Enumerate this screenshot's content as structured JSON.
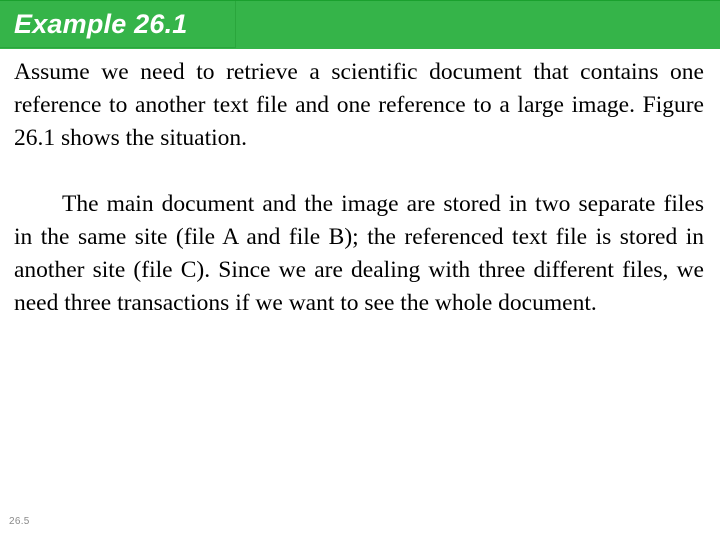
{
  "slide": {
    "title": "Example 26.1",
    "page_number": "26.5",
    "accent_color": "#35b449",
    "title_color": "#ffffff",
    "body_color": "#000000",
    "page_number_color": "#8a8a8a",
    "background_color": "#ffffff"
  },
  "body": {
    "paragraphs": [
      "Assume we need to retrieve a scientific document that contains one reference to another text file and one reference to a large image. Figure 26.1 shows the situation.",
      "The main document and the image are stored in two separate files in the same site (file A and file B); the referenced text file is stored in another site (file C). Since we are dealing with three different files, we need three transactions if we want to see the whole document."
    ]
  }
}
